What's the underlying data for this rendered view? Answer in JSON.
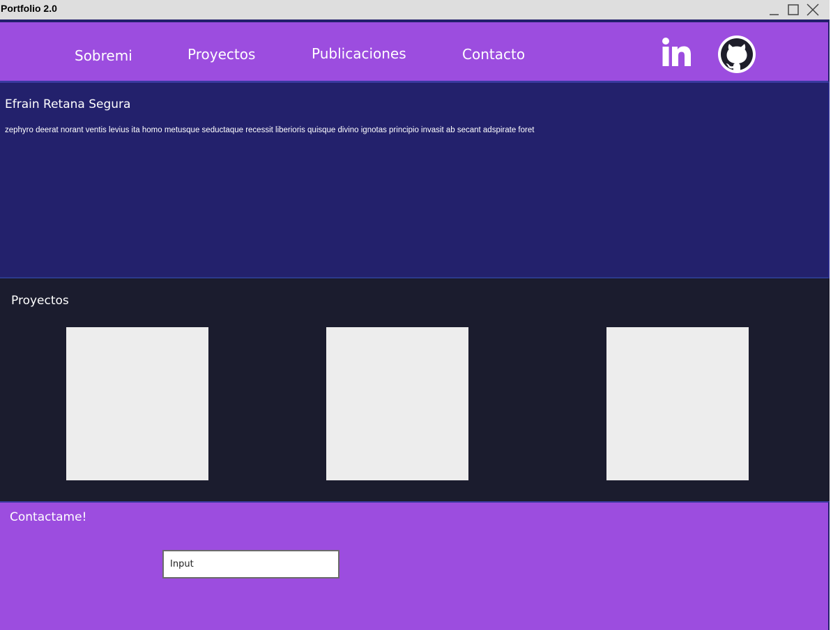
{
  "window": {
    "title": "Portfolio 2.0"
  },
  "nav": {
    "items": [
      {
        "label": "Sobremi"
      },
      {
        "label": "Proyectos"
      },
      {
        "label": "Publicaciones"
      },
      {
        "label": "Contacto"
      }
    ],
    "social": [
      {
        "icon": "linkedin-icon"
      },
      {
        "icon": "github-icon"
      }
    ]
  },
  "hero": {
    "name": "Efrain Retana Segura",
    "description": "zephyro deerat norant ventis levius ita homo metusque seductaque recessit liberioris quisque divino ignotas principio invasit ab secant adspirate foret"
  },
  "projects": {
    "heading": "Proyectos"
  },
  "contact": {
    "heading": "Contactame!",
    "input_placeholder": "Input"
  },
  "colors": {
    "nav_bg": "#9c4ddf",
    "hero_bg": "#23216c",
    "projects_bg": "#1b1c2e",
    "card_bg": "#ededed",
    "contact_bg": "#9c4ddf"
  }
}
